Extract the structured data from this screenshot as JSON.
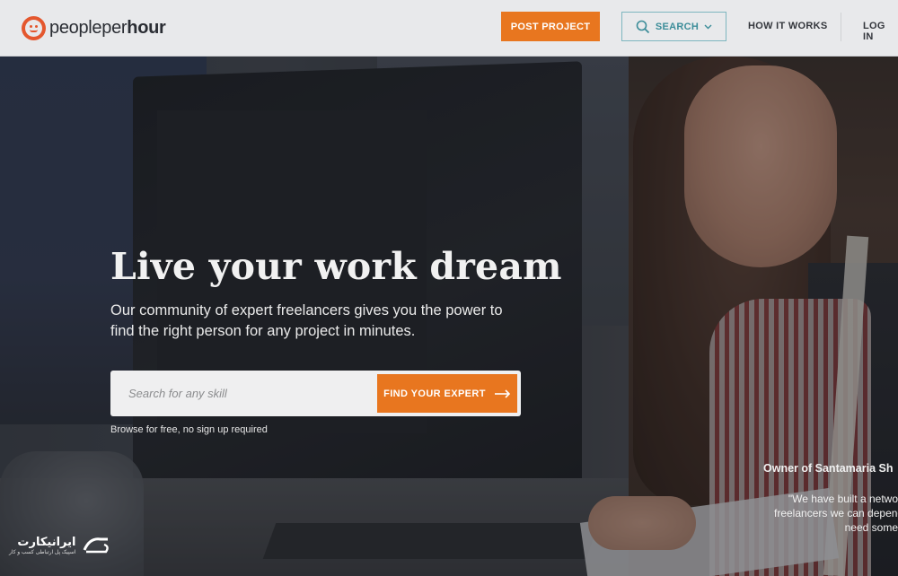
{
  "header": {
    "logo": {
      "part1": "people",
      "part2": "per",
      "part3": "hour"
    },
    "post_project_label": "POST PROJECT",
    "search_label": "SEARCH",
    "how_it_works_label": "HOW IT WORKS",
    "login_label": "LOG IN"
  },
  "hero": {
    "title": "Live your work dream",
    "subtitle": "Our community of expert freelancers gives you the power to find the right person for any project in minutes.",
    "search_placeholder": "Search for any skill",
    "find_button_label": "FIND YOUR EXPERT",
    "browse_note": "Browse for free, no sign up required"
  },
  "testimonial": {
    "name": "Owner of Santamaria Sh",
    "quote_lines": [
      "\"We have built a netwo",
      "freelancers we can depend",
      "need some"
    ]
  },
  "watermark": {
    "text": "ایرانیکارت",
    "subtext": "اسپیک پل ارتباطی کسب و کار"
  },
  "colors": {
    "accent_orange": "#e8761f",
    "search_teal": "#3c8d99",
    "logo_red": "#e4572e"
  },
  "icons": {
    "search": "search-icon",
    "chevron": "chevron-down-icon",
    "arrow": "arrow-right-icon"
  }
}
